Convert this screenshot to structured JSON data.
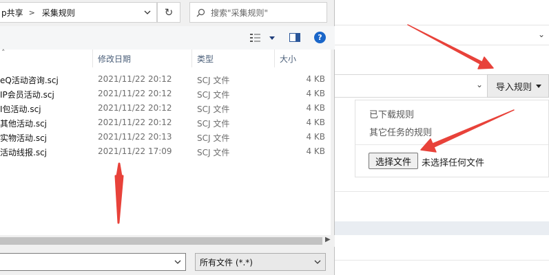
{
  "dialog": {
    "breadcrumb": [
      "p共享",
      "采集规则"
    ],
    "search_placeholder": "搜索\"采集规则\"",
    "columns": {
      "date": "修改日期",
      "type": "类型",
      "size": "大小"
    },
    "files": [
      {
        "name": "eQ活动咨询.scj",
        "date": "2021/11/22 20:12",
        "type": "SCJ 文件",
        "size": "4 KB"
      },
      {
        "name": "IP会员活动.scj",
        "date": "2021/11/22 20:12",
        "type": "SCJ 文件",
        "size": "4 KB"
      },
      {
        "name": "I包活动.scj",
        "date": "2021/11/22 20:12",
        "type": "SCJ 文件",
        "size": "4 KB"
      },
      {
        "name": "其他活动.scj",
        "date": "2021/11/22 20:12",
        "type": "SCJ 文件",
        "size": "4 KB"
      },
      {
        "name": "实物活动.scj",
        "date": "2021/11/22 20:13",
        "type": "SCJ 文件",
        "size": "4 KB"
      },
      {
        "name": "活动线报.scj",
        "date": "2021/11/22 17:09",
        "type": "SCJ 文件",
        "size": "4 KB"
      }
    ],
    "file_type_filter": "所有文件 (*.*)",
    "file_name_value": ""
  },
  "web": {
    "import_button": "导入规则",
    "menu_items": [
      "已下载规则",
      "其它任务的规则"
    ],
    "choose_file_button": "选择文件",
    "no_file_text": "未选择任何文件"
  },
  "colors": {
    "arrow_red": "#e8423a",
    "link_blue": "#1a66c9"
  },
  "icons": [
    "chevron-down-icon",
    "refresh-icon",
    "search-icon",
    "view-options-icon",
    "preview-pane-icon",
    "help-icon",
    "sort-up-icon",
    "scroll-right-icon"
  ]
}
